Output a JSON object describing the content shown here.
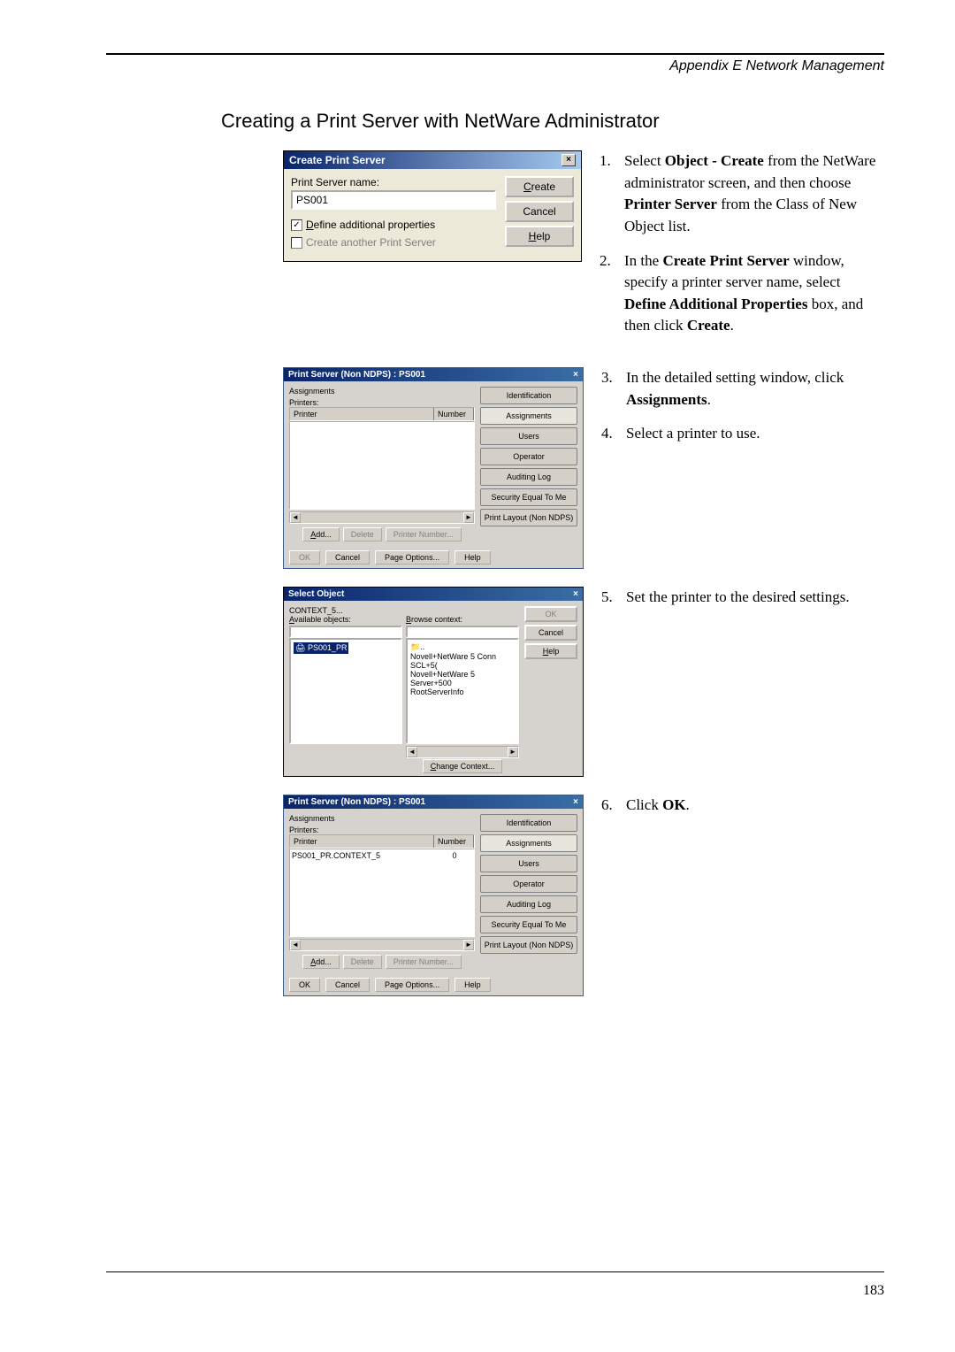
{
  "header": {
    "appendix": "Appendix E Network Management"
  },
  "section_title": "Creating a Print Server with NetWare Administrator",
  "dialog1": {
    "title": "Create Print Server",
    "close": "×",
    "name_label": "Print Server name:",
    "name_value": "PS001",
    "check1_label": "Define additional properties",
    "check2_label": "Create another Print Server",
    "btn_create": "Create",
    "btn_cancel": "Cancel",
    "btn_help": "Help"
  },
  "dialog2": {
    "title": "Print Server (Non NDPS) : PS001",
    "tab_header": "Assignments",
    "printers_label": "Printers:",
    "col_printer": "Printer",
    "col_number": "Number",
    "btn_add": "Add...",
    "btn_delete": "Delete",
    "btn_printnum": "Printer Number...",
    "btn_ok": "OK",
    "btn_cancel": "Cancel",
    "btn_pageopt": "Page Options...",
    "btn_help": "Help",
    "tabs": {
      "identification": "Identification",
      "assignments": "Assignments",
      "users": "Users",
      "operator": "Operator",
      "auditing": "Auditing Log",
      "security": "Security Equal To Me",
      "printlayout": "Print Layout (Non NDPS)"
    }
  },
  "dialog3": {
    "title": "Select Object",
    "context": "CONTEXT_5...",
    "avail_label": "Available objects:",
    "browse_label": "Browse context:",
    "item": "PS001_PR",
    "tree_items": [
      "Novell+NetWare 5 Conn SCL+5(",
      "Novell+NetWare 5 Server+500",
      "RootServerInfo"
    ],
    "btn_ok": "OK",
    "btn_cancel": "Cancel",
    "btn_help": "Help",
    "btn_change": "Change Context..."
  },
  "dialog4": {
    "title": "Print Server (Non NDPS) : PS001",
    "tab_header": "Assignments",
    "printers_label": "Printers:",
    "col_printer": "Printer",
    "col_number": "Number",
    "row_printer": "PS001_PR.CONTEXT_5",
    "row_number": "0",
    "btn_add": "Add...",
    "btn_delete": "Delete",
    "btn_printnum": "Printer Number...",
    "btn_ok": "OK",
    "btn_cancel": "Cancel",
    "btn_pageopt": "Page Options...",
    "btn_help": "Help",
    "tabs": {
      "identification": "Identification",
      "assignments": "Assignments",
      "users": "Users",
      "operator": "Operator",
      "auditing": "Auditing Log",
      "security": "Security Equal To Me",
      "printlayout": "Print Layout (Non NDPS)"
    }
  },
  "instructions": {
    "i1_num": "1.",
    "i1_a": "Select ",
    "i1_b": "Object - Create",
    "i1_c": " from the NetWare administrator screen, and then choose ",
    "i1_d": "Printer Server",
    "i1_e": " from the Class of New Object list.",
    "i2_num": "2.",
    "i2_a": "In the ",
    "i2_b": "Create Print Server",
    "i2_c": " window, specify a printer server name, select ",
    "i2_d": "Define Additional Properties",
    "i2_e": " box, and then click ",
    "i2_f": "Create",
    "i2_g": ".",
    "i3_num": "3.",
    "i3_a": "In the detailed setting window, click ",
    "i3_b": "Assignments",
    "i3_c": ".",
    "i4_num": "4.",
    "i4_a": "Select a printer to use.",
    "i5_num": "5.",
    "i5_a": "Set the printer to the desired settings.",
    "i6_num": "6.",
    "i6_a": "Click ",
    "i6_b": "OK",
    "i6_c": "."
  },
  "page_number": "183"
}
